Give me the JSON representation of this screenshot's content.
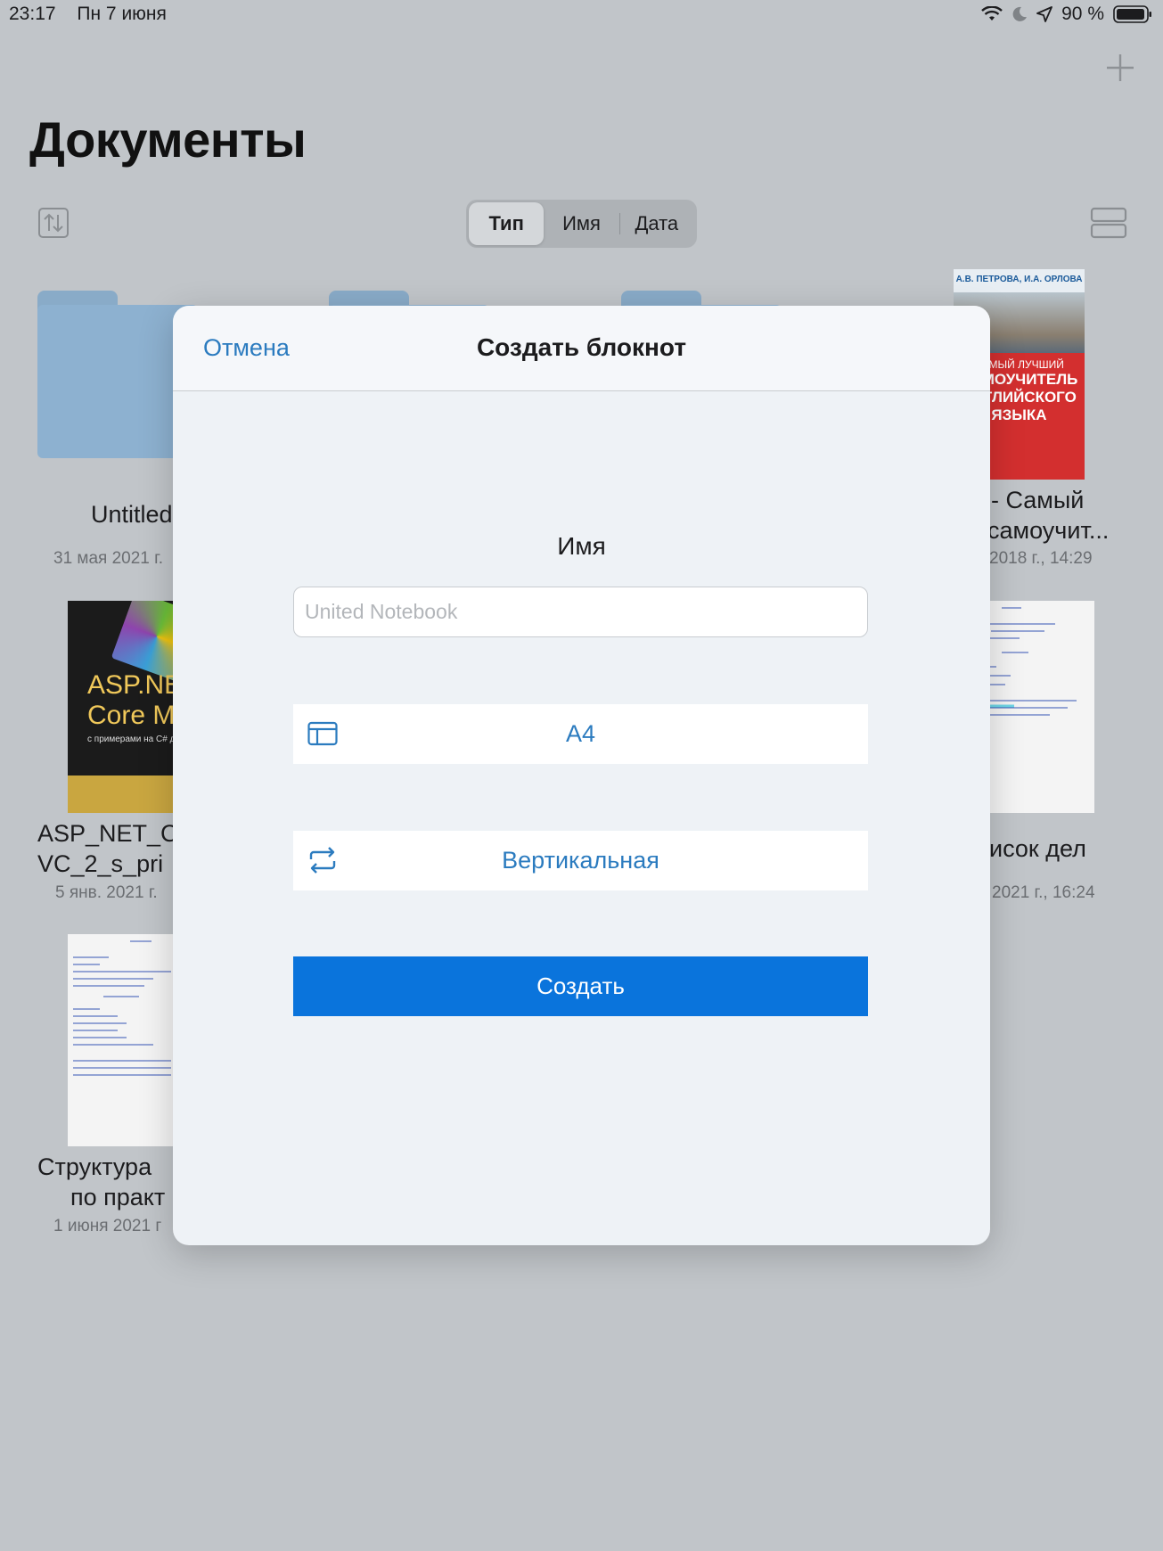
{
  "status_bar": {
    "time": "23:17",
    "date": "Пн 7 июня",
    "battery": "90 %",
    "icons": [
      "wifi-icon",
      "moon-icon",
      "location-icon",
      "battery-icon"
    ]
  },
  "header": {
    "title": "Документы",
    "add_icon": "plus-icon",
    "sort_icon": "sort-icon",
    "view_icon": "list-view-icon"
  },
  "sort_segments": [
    "Тип",
    "Имя",
    "Дата"
  ],
  "sort_selected": "Тип",
  "documents": [
    {
      "label_line1": "Untitled",
      "label_line2": "",
      "date": "31 мая 2021 г."
    },
    {
      "label_line1": "- Самый",
      "label_line2": "самоучит...",
      "date": "2018 г., 14:29"
    },
    {
      "label_line1": "ASP_NET_C",
      "label_line2": "VC_2_s_pri",
      "date": "5 янв. 2021 г."
    },
    {
      "label_line1": "исок дел",
      "label_line2": "",
      "date": "2021 г., 16:24"
    },
    {
      "label_line1": "Структура",
      "label_line2": "по практ",
      "date": "1 июня 2021 г"
    }
  ],
  "thumb_texts": {
    "asp_book_title1": "ASP.NET",
    "asp_book_title2": "Core MVC",
    "asp_book_sub": "с примерами на C# для про",
    "eng_book_authors": "А.В. ПЕТРОВА, И.А. ОРЛОВА",
    "eng_book_line1": "САМЫЙ ЛУЧШИЙ",
    "eng_book_line2": "САМОУЧИТЕЛЬ",
    "eng_book_line3": "АНГЛИЙСКОГО",
    "eng_book_line4": "ЯЗЫКА"
  },
  "modal": {
    "cancel_label": "Отмена",
    "title": "Создать блокнот",
    "name_label": "Имя",
    "name_placeholder": "United Notebook",
    "name_value": "",
    "paper_size": "A4",
    "paper_icon": "page-layout-icon",
    "orientation": "Вертикальная",
    "orientation_icon": "rotate-icon",
    "create_label": "Создать"
  },
  "colors": {
    "accent": "#2b7bbf",
    "primary_button": "#0a74dc",
    "backdrop": "#c1c5c9",
    "modal_bg": "#eef2f6"
  }
}
